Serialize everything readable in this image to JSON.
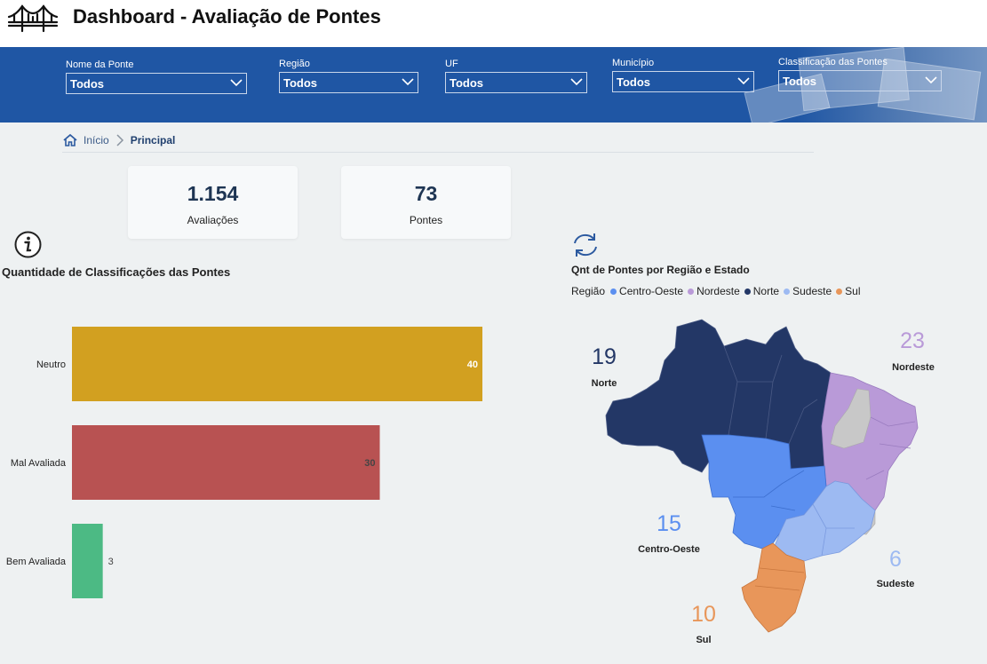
{
  "header": {
    "title": "Dashboard - Avaliação de Pontes",
    "logo_icon": "bridge-icon"
  },
  "filters": [
    {
      "label": "Nome da Ponte",
      "value": "Todos"
    },
    {
      "label": "Região",
      "value": "Todos"
    },
    {
      "label": "UF",
      "value": "Todos"
    },
    {
      "label": "Município",
      "value": "Todos"
    },
    {
      "label": "Classificação das Pontes",
      "value": "Todos"
    }
  ],
  "breadcrumb": {
    "home": "Início",
    "current": "Principal"
  },
  "kpis": [
    {
      "value": "1.154",
      "label": "Avaliações"
    },
    {
      "value": "73",
      "label": "Pontes"
    }
  ],
  "chart_data": [
    {
      "type": "bar",
      "orientation": "horizontal",
      "title": "Quantidade de Classificações das Pontes",
      "categories": [
        "Neutro",
        "Mal Avaliada",
        "Bem Avaliada"
      ],
      "values": [
        40,
        30,
        3
      ],
      "colors": [
        "#d2a020",
        "#b85252",
        "#4cba84"
      ],
      "xlim": [
        0,
        40
      ]
    },
    {
      "type": "map",
      "title": "Qnt de Pontes por Região e Estado",
      "legend_title": "Região",
      "legend": [
        {
          "name": "Centro-Oeste",
          "color": "#5b8ff0"
        },
        {
          "name": "Nordeste",
          "color": "#b99ad8"
        },
        {
          "name": "Norte",
          "color": "#233766"
        },
        {
          "name": "Sudeste",
          "color": "#9dbaf2"
        },
        {
          "name": "Sul",
          "color": "#e8965a"
        }
      ],
      "regions": [
        {
          "name": "Norte",
          "value": "19",
          "color": "#233766"
        },
        {
          "name": "Nordeste",
          "value": "23",
          "color": "#b99ad8"
        },
        {
          "name": "Centro-Oeste",
          "value": "15",
          "color": "#5b8ff0"
        },
        {
          "name": "Sudeste",
          "value": "6",
          "color": "#9dbaf2"
        },
        {
          "name": "Sul",
          "value": "10",
          "color": "#e8965a"
        }
      ]
    }
  ],
  "colors": {
    "band": "#1f56a4",
    "kpi_text": "#1e3553",
    "no_data": "#c8c8c8"
  }
}
